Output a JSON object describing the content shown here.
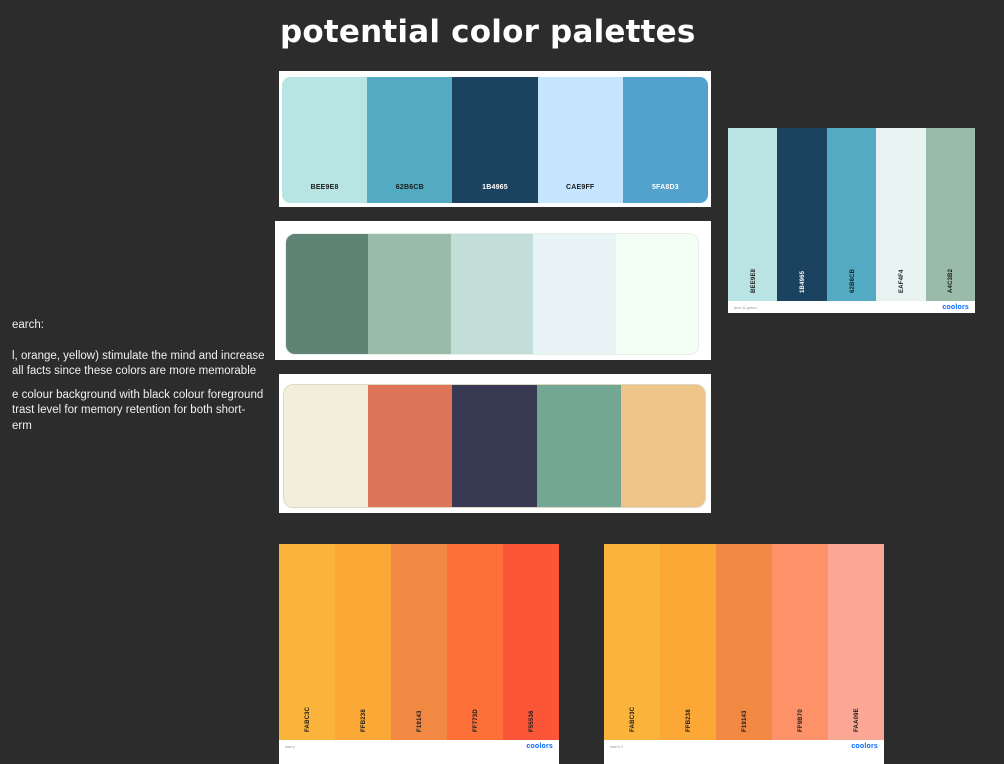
{
  "title": "potential color palettes",
  "notes": [
    "earch:",
    "l, orange, yellow) stimulate the mind and increase",
    "all facts since these colors are more memorable",
    "e colour background with black colour foreground",
    "trast level for memory retention for both short-",
    "erm"
  ],
  "palettes": {
    "blue": {
      "colors": [
        "#B8E4E3",
        "#53ABC3",
        "#1B4360",
        "#C5E6FE",
        "#53A1CD"
      ],
      "labels": [
        "BEE9E8",
        "62B6CB",
        "1B4965",
        "CAE9FF",
        "5FA8D3"
      ]
    },
    "green": {
      "colors": [
        "#5F8374",
        "#9BBBAA",
        "#C3DDD9",
        "#E7F3F4",
        "#F3FEF5"
      ]
    },
    "mixed": {
      "colors": [
        "#F1EEDC",
        "#DE7458",
        "#383952",
        "#73A793",
        "#EFC489"
      ]
    },
    "blue_green": {
      "colors": [
        "#B9E4E3",
        "#1B4360",
        "#53ABC3",
        "#E8F3F2",
        "#9BBBAA"
      ],
      "labels": [
        "BEE9E8",
        "1B4965",
        "62B6CB",
        "EAF4F4",
        "A4C3B2"
      ],
      "name": "blue & green",
      "logo": "coolors"
    },
    "warm": {
      "colors": [
        "#FAB43C",
        "#FCA836",
        "#F28942",
        "#FE7037",
        "#FB5637"
      ],
      "labels": [
        "FABC3C",
        "FFB238",
        "F19143",
        "FF773D",
        "F55536"
      ],
      "name": "warm",
      "logo": "coolors"
    },
    "warm2": {
      "colors": [
        "#FAB43C",
        "#FCA836",
        "#F28942",
        "#FD9168",
        "#FAA795"
      ],
      "labels": [
        "FABC3C",
        "FFB238",
        "F19143",
        "FF9B70",
        "FAA09E"
      ],
      "name": "warm 2",
      "logo": "coolors"
    }
  },
  "label_colors": {
    "dark": "#1a1a1a",
    "light": "#ffffff"
  }
}
